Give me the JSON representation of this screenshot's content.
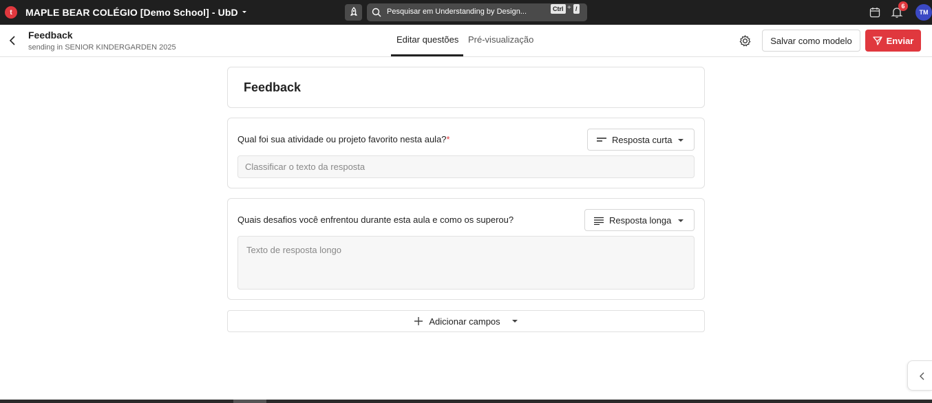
{
  "topbar": {
    "logo_letter": "t",
    "school_name": "MAPLE BEAR COLÉGIO [Demo School] - UbD",
    "search_placeholder": "Pesquisar em Understanding by Design...",
    "shortcut_ctrl": "Ctrl",
    "shortcut_plus": "+",
    "shortcut_key": "/",
    "notification_count": "6",
    "avatar_initials": "TM",
    "brand_color": "#e0383e"
  },
  "header": {
    "title": "Feedback",
    "subtitle": "sending in SENIOR KINDERGARDEN 2025",
    "tabs": [
      {
        "label": "Editar questões",
        "active": true
      },
      {
        "label": "Pré-visualização",
        "active": false
      }
    ],
    "save_template_label": "Salvar como modelo",
    "send_label": "Enviar"
  },
  "form": {
    "title": "Feedback",
    "questions": [
      {
        "label": "Qual foi sua atividade ou projeto favorito nesta aula?",
        "required_mark": "*",
        "type_label": "Resposta curta",
        "placeholder": "Classificar o texto da resposta"
      },
      {
        "label": "Quais desafios você enfrentou durante esta aula e como os superou?",
        "type_label": "Resposta longa",
        "placeholder": "Texto de resposta longo"
      }
    ],
    "add_fields_label": "Adicionar campos"
  }
}
